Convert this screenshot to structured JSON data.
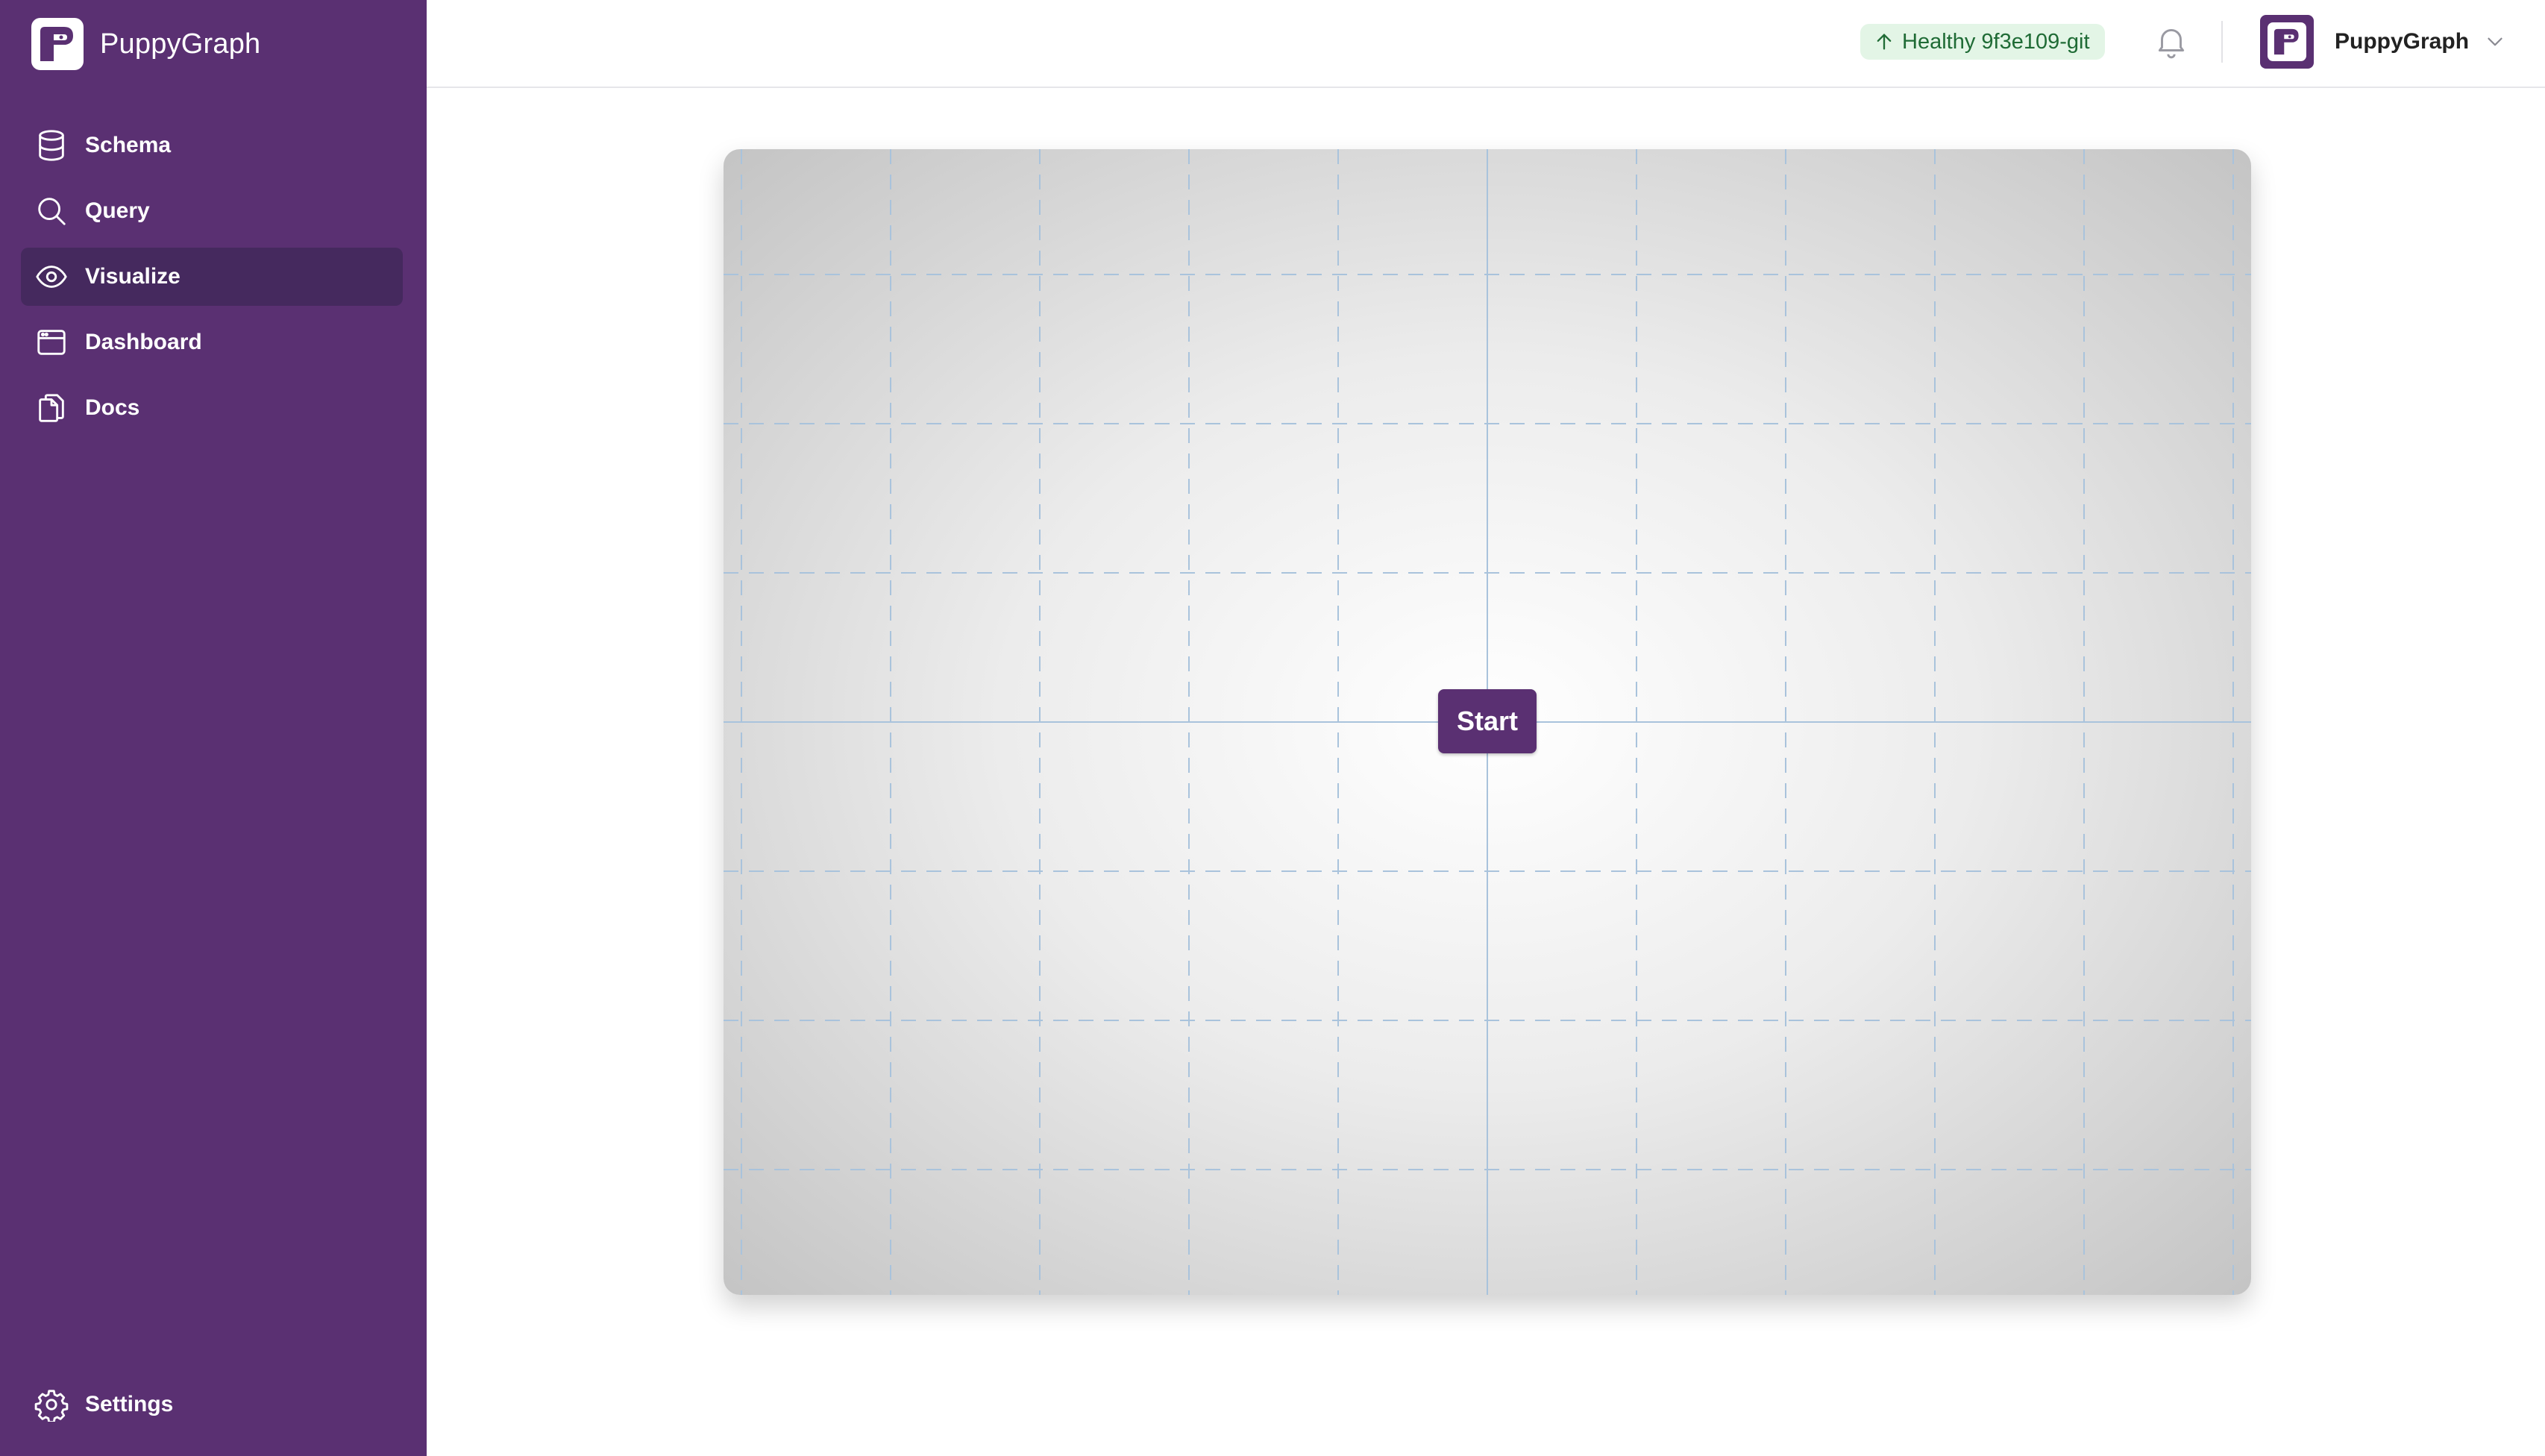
{
  "app": {
    "brand_name": "PuppyGraph"
  },
  "sidebar": {
    "items": [
      {
        "label": "Schema",
        "icon": "database-icon",
        "active": false
      },
      {
        "label": "Query",
        "icon": "search-icon",
        "active": false
      },
      {
        "label": "Visualize",
        "icon": "eye-icon",
        "active": true
      },
      {
        "label": "Dashboard",
        "icon": "dashboard-icon",
        "active": false
      },
      {
        "label": "Docs",
        "icon": "docs-icon",
        "active": false
      }
    ],
    "settings_label": "Settings"
  },
  "header": {
    "status_text": "Healthy 9f3e109-git",
    "user_name": "PuppyGraph"
  },
  "canvas": {
    "start_label": "Start"
  },
  "colors": {
    "sidebar_bg": "#5a3072",
    "sidebar_active": "#45295e",
    "status_bg": "#e3f5e6",
    "status_text": "#1f6b35",
    "grid_line": "#a9c3dc"
  }
}
